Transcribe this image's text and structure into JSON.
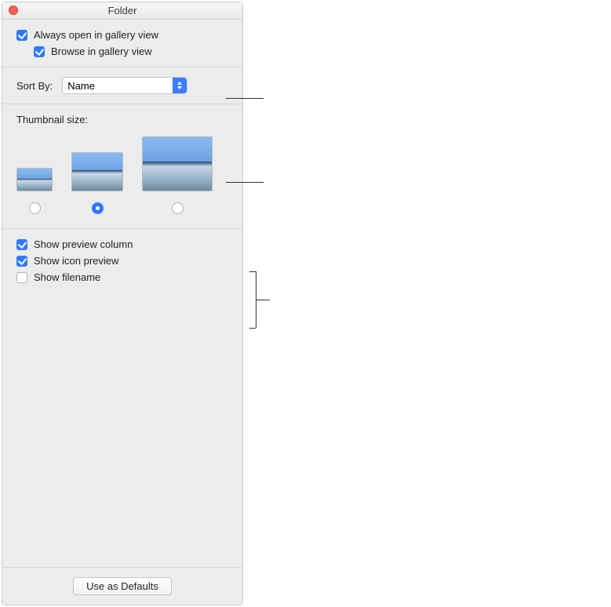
{
  "title": "Folder",
  "view": {
    "always_open_label": "Always open in gallery view",
    "always_open_checked": true,
    "browse_label": "Browse in gallery view",
    "browse_checked": true
  },
  "sort": {
    "label": "Sort By:",
    "value": "Name"
  },
  "thumbnail": {
    "label": "Thumbnail size:",
    "selected_index": 1
  },
  "options": {
    "show_preview_column_label": "Show preview column",
    "show_preview_column_checked": true,
    "show_icon_preview_label": "Show icon preview",
    "show_icon_preview_checked": true,
    "show_filename_label": "Show filename",
    "show_filename_checked": false
  },
  "footer": {
    "use_defaults_label": "Use as Defaults"
  }
}
